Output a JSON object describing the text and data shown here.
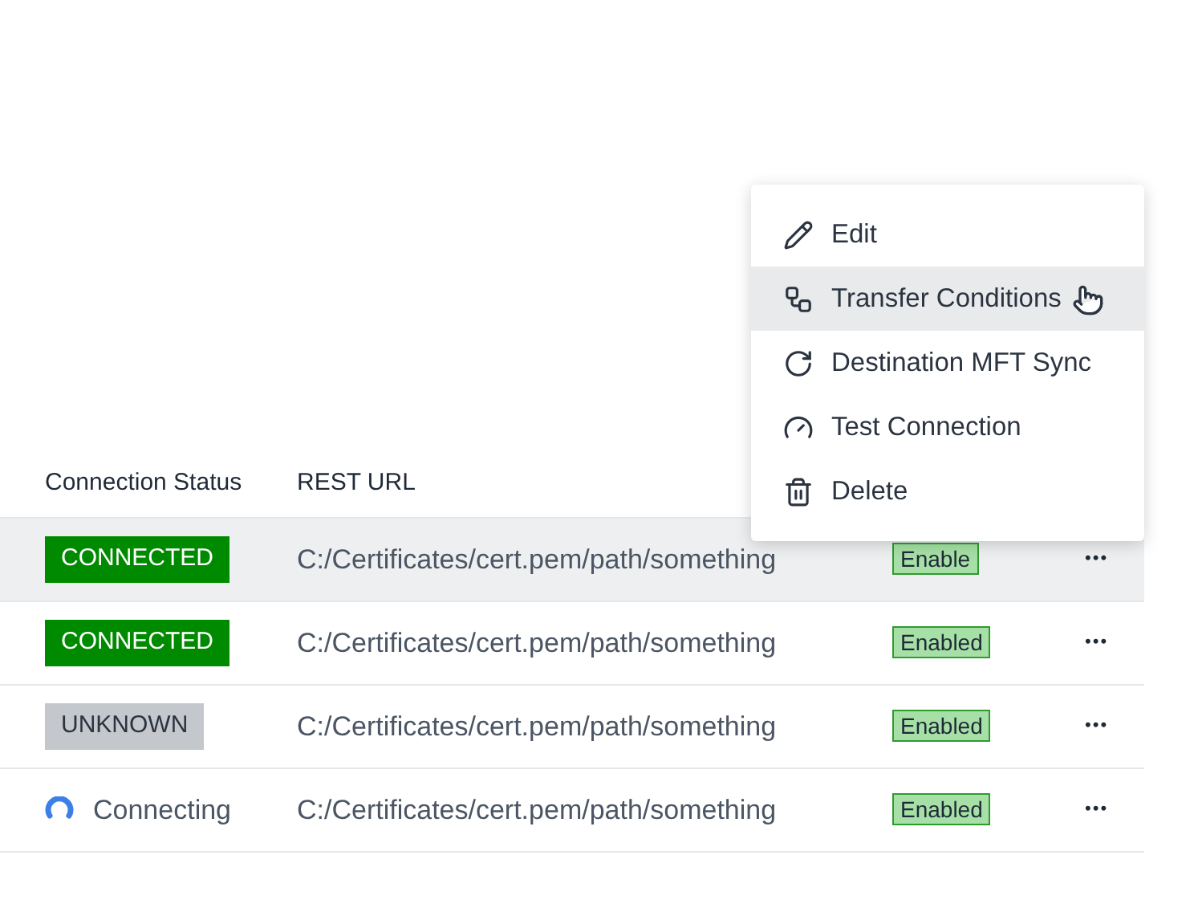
{
  "table": {
    "columns": [
      "Connection Status",
      "REST URL"
    ],
    "rows": [
      {
        "selected": true,
        "status": {
          "kind": "connected",
          "label": "CONNECTED"
        },
        "url": "C:/Certificates/cert.pem/path/something",
        "enabled": "Enable",
        "actions": "•••"
      },
      {
        "selected": false,
        "status": {
          "kind": "connected",
          "label": "CONNECTED"
        },
        "url": "C:/Certificates/cert.pem/path/something",
        "enabled": "Enabled",
        "actions": "•••"
      },
      {
        "selected": false,
        "status": {
          "kind": "unknown",
          "label": "UNKNOWN"
        },
        "url": "C:/Certificates/cert.pem/path/something",
        "enabled": "Enabled",
        "actions": "•••"
      },
      {
        "selected": false,
        "status": {
          "kind": "connecting",
          "label": "Connecting"
        },
        "url": "C:/Certificates/cert.pem/path/something",
        "enabled": "Enabled",
        "actions": "•••"
      }
    ]
  },
  "menu": {
    "items": [
      {
        "kind": "edit",
        "label": "Edit",
        "selected": false
      },
      {
        "kind": "transfer",
        "label": "Transfer Conditions",
        "selected": true
      },
      {
        "kind": "sync",
        "label": "Destination MFT Sync",
        "selected": false
      },
      {
        "kind": "test",
        "label": "Test Connection",
        "selected": false
      },
      {
        "kind": "delete",
        "label": "Delete",
        "selected": false
      }
    ]
  }
}
